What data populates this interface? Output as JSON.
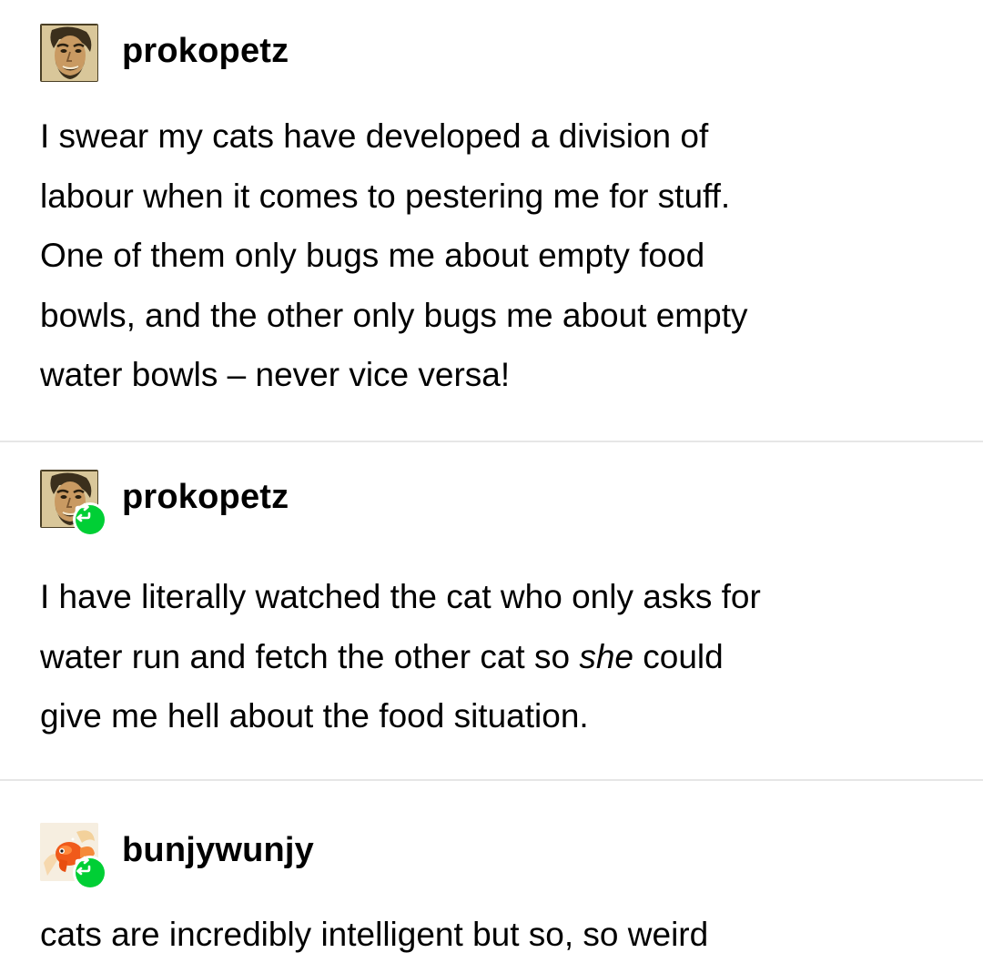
{
  "posts": [
    {
      "username": "prokopetz",
      "avatar_icon": "portrait-avatar",
      "reblogged": false,
      "lines": [
        "I swear my cats have developed a division of",
        "labour when it comes to pestering me for stuff.",
        "One of them only bugs me about empty food",
        "bowls, and the other only bugs me about empty",
        "water bowls – never vice versa!"
      ]
    },
    {
      "username": "prokopetz",
      "avatar_icon": "portrait-avatar",
      "reblogged": true,
      "lines": [
        "I have literally watched the cat who only asks for",
        {
          "before": "water run and fetch the other cat so ",
          "em": "she",
          "after": " could"
        },
        "give me hell about the food situation."
      ]
    },
    {
      "username": "bunjywunjy",
      "avatar_icon": "goldfish-avatar",
      "reblogged": true,
      "lines": [
        "cats are incredibly intelligent but so, so weird"
      ]
    }
  ],
  "colors": {
    "reblog_badge": "#00cf35",
    "divider": "#e6e6e6",
    "text": "#000000",
    "background": "#ffffff"
  }
}
